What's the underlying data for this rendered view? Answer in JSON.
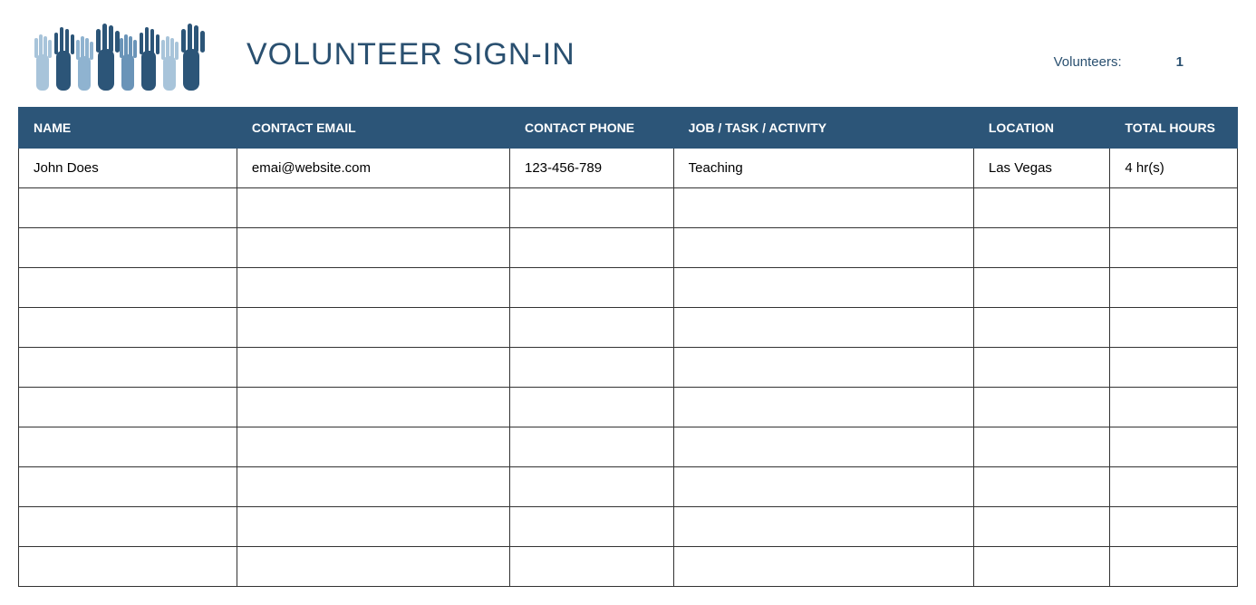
{
  "header": {
    "title": "VOLUNTEER SIGN-IN",
    "volunteers_label": "Volunteers:",
    "volunteers_count": "1"
  },
  "table": {
    "columns": [
      "NAME",
      "CONTACT EMAIL",
      "CONTACT PHONE",
      "JOB / TASK / ACTIVITY",
      "LOCATION",
      "TOTAL HOURS"
    ],
    "rows": [
      {
        "name": "John Does",
        "email": "emai@website.com",
        "phone": "123-456-789",
        "job": "Teaching",
        "location": "Las Vegas",
        "hours": "4 hr(s)"
      },
      {
        "name": "",
        "email": "",
        "phone": "",
        "job": "",
        "location": "",
        "hours": ""
      },
      {
        "name": "",
        "email": "",
        "phone": "",
        "job": "",
        "location": "",
        "hours": ""
      },
      {
        "name": "",
        "email": "",
        "phone": "",
        "job": "",
        "location": "",
        "hours": ""
      },
      {
        "name": "",
        "email": "",
        "phone": "",
        "job": "",
        "location": "",
        "hours": ""
      },
      {
        "name": "",
        "email": "",
        "phone": "",
        "job": "",
        "location": "",
        "hours": ""
      },
      {
        "name": "",
        "email": "",
        "phone": "",
        "job": "",
        "location": "",
        "hours": ""
      },
      {
        "name": "",
        "email": "",
        "phone": "",
        "job": "",
        "location": "",
        "hours": ""
      },
      {
        "name": "",
        "email": "",
        "phone": "",
        "job": "",
        "location": "",
        "hours": ""
      },
      {
        "name": "",
        "email": "",
        "phone": "",
        "job": "",
        "location": "",
        "hours": ""
      },
      {
        "name": "",
        "email": "",
        "phone": "",
        "job": "",
        "location": "",
        "hours": ""
      }
    ]
  }
}
